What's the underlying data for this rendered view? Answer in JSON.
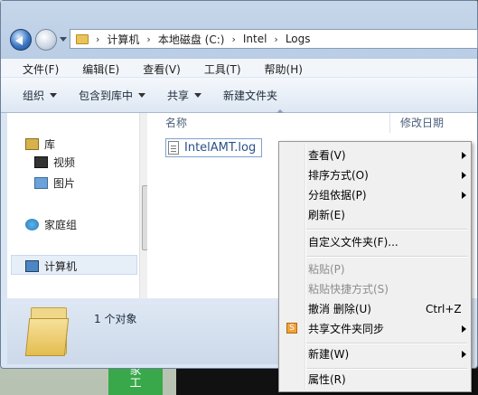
{
  "address": {
    "crumbs": [
      "计算机",
      "本地磁盘 (C:)",
      "Intel",
      "Logs"
    ]
  },
  "menubar": [
    "文件(F)",
    "编辑(E)",
    "查看(V)",
    "工具(T)",
    "帮助(H)"
  ],
  "toolbar": {
    "organize": "组织",
    "include_library": "包含到库中",
    "share": "共享",
    "new_folder": "新建文件夹"
  },
  "nav": {
    "library": "库",
    "video": "视频",
    "pictures": "图片",
    "homegroup": "家庭组",
    "computer": "计算机"
  },
  "content": {
    "col_name": "名称",
    "col_modified": "修改日期",
    "file_name": "IntelAMT.log"
  },
  "details": {
    "object_count": "1 个对象"
  },
  "context_menu": {
    "view": "查看(V)",
    "sort": "排序方式(O)",
    "group": "分组依据(P)",
    "refresh": "刷新(E)",
    "customize": "自定义文件夹(F)...",
    "paste": "粘贴(P)",
    "paste_shortcut": "粘贴快捷方式(S)",
    "undo_delete": "撤消 删除(U)",
    "undo_shortcut": "Ctrl+Z",
    "share_sync": "共享文件夹同步",
    "new": "新建(W)",
    "properties": "属性(R)"
  },
  "background": {
    "green_tile": "家\n工"
  },
  "colors": {
    "accent_blue": "#2a4f8a",
    "share_icon": "#f3a23b",
    "disabled_text": "#8d8d8d"
  }
}
